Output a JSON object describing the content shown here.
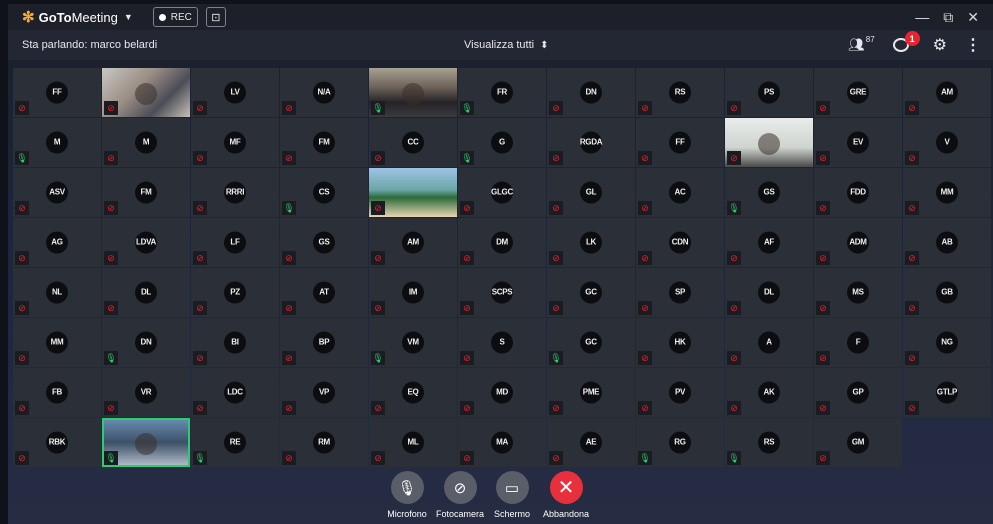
{
  "titlebar": {
    "app_name_bold": "GoTo",
    "app_name_rest": "Meeting",
    "rec_label": "REC",
    "minimize": "—",
    "restore": "⧉",
    "close": "✕"
  },
  "infobar": {
    "speaking": "Sta parlando: marco belardi",
    "view_all": "Visualizza tutti",
    "participants_count": "87",
    "chat_badge": "1"
  },
  "participants": [
    {
      "initials": "FF",
      "mic": "muted"
    },
    {
      "initials": "",
      "mic": "muted",
      "video": "vid1"
    },
    {
      "initials": "LV",
      "mic": "muted"
    },
    {
      "initials": "N/A",
      "mic": "muted"
    },
    {
      "initials": "",
      "mic": "on",
      "video": "vid2"
    },
    {
      "initials": "FR",
      "mic": "on"
    },
    {
      "initials": "DN",
      "mic": "muted"
    },
    {
      "initials": "RS",
      "mic": "muted"
    },
    {
      "initials": "PS",
      "mic": "muted"
    },
    {
      "initials": "GRE",
      "mic": "muted"
    },
    {
      "initials": "M",
      "mic": "on"
    },
    {
      "initials": "M",
      "mic": "muted"
    },
    {
      "initials": "MF",
      "mic": "muted"
    },
    {
      "initials": "FM",
      "mic": "muted"
    },
    {
      "initials": "CC",
      "mic": "muted"
    },
    {
      "initials": "G",
      "mic": "on"
    },
    {
      "initials": "RGDA",
      "mic": "muted"
    },
    {
      "initials": "FF",
      "mic": "muted"
    },
    {
      "initials": "",
      "mic": "muted",
      "video": "vid3"
    },
    {
      "initials": "EV",
      "mic": "muted"
    },
    {
      "initials": "ASV",
      "mic": "muted"
    },
    {
      "initials": "FM",
      "mic": "muted"
    },
    {
      "initials": "RRRI",
      "mic": "muted"
    },
    {
      "initials": "CS",
      "mic": "on"
    },
    {
      "initials": "",
      "mic": "muted",
      "video": "vid4"
    },
    {
      "initials": "GLGC",
      "mic": "muted"
    },
    {
      "initials": "GL",
      "mic": "muted"
    },
    {
      "initials": "AC",
      "mic": "muted"
    },
    {
      "initials": "GS",
      "mic": "on"
    },
    {
      "initials": "FDD",
      "mic": "muted"
    },
    {
      "initials": "AG",
      "mic": "muted"
    },
    {
      "initials": "LDVA",
      "mic": "muted"
    },
    {
      "initials": "LF",
      "mic": "muted"
    },
    {
      "initials": "GS",
      "mic": "muted"
    },
    {
      "initials": "AM",
      "mic": "muted"
    },
    {
      "initials": "DM",
      "mic": "muted"
    },
    {
      "initials": "LK",
      "mic": "muted"
    },
    {
      "initials": "CDN",
      "mic": "muted"
    },
    {
      "initials": "AF",
      "mic": "muted"
    },
    {
      "initials": "ADM",
      "mic": "muted"
    },
    {
      "initials": "NL",
      "mic": "muted"
    },
    {
      "initials": "DL",
      "mic": "muted"
    },
    {
      "initials": "PZ",
      "mic": "muted"
    },
    {
      "initials": "AT",
      "mic": "muted"
    },
    {
      "initials": "IM",
      "mic": "muted"
    },
    {
      "initials": "SCPS",
      "mic": "muted"
    },
    {
      "initials": "GC",
      "mic": "muted"
    },
    {
      "initials": "SP",
      "mic": "muted"
    },
    {
      "initials": "DL",
      "mic": "muted"
    },
    {
      "initials": "MS",
      "mic": "muted"
    },
    {
      "initials": "MM",
      "mic": "muted"
    },
    {
      "initials": "DN",
      "mic": "on"
    },
    {
      "initials": "BI",
      "mic": "muted"
    },
    {
      "initials": "BP",
      "mic": "muted"
    },
    {
      "initials": "VM",
      "mic": "on"
    },
    {
      "initials": "S",
      "mic": "muted"
    },
    {
      "initials": "GC",
      "mic": "on"
    },
    {
      "initials": "HK",
      "mic": "muted"
    },
    {
      "initials": "A",
      "mic": "muted"
    },
    {
      "initials": "F",
      "mic": "muted"
    },
    {
      "initials": "FB",
      "mic": "muted"
    },
    {
      "initials": "VR",
      "mic": "muted"
    },
    {
      "initials": "LDC",
      "mic": "muted"
    },
    {
      "initials": "VP",
      "mic": "muted"
    },
    {
      "initials": "EQ",
      "mic": "muted"
    },
    {
      "initials": "MD",
      "mic": "muted"
    },
    {
      "initials": "PME",
      "mic": "muted"
    },
    {
      "initials": "PV",
      "mic": "muted"
    },
    {
      "initials": "AK",
      "mic": "muted"
    },
    {
      "initials": "GP",
      "mic": "muted"
    },
    {
      "initials": "RBK",
      "mic": "muted"
    },
    {
      "initials": "",
      "mic": "on",
      "video": "vid5"
    },
    {
      "initials": "RE",
      "mic": "on"
    },
    {
      "initials": "RM",
      "mic": "muted"
    },
    {
      "initials": "ML",
      "mic": "muted"
    },
    {
      "initials": "MA",
      "mic": "muted"
    },
    {
      "initials": "AE",
      "mic": "muted"
    },
    {
      "initials": "RG",
      "mic": "on"
    },
    {
      "initials": "RS",
      "mic": "on"
    },
    {
      "initials": "GM",
      "mic": "muted"
    }
  ],
  "overflow_column": [
    {
      "initials": "AM",
      "mic": "muted"
    },
    {
      "initials": "V",
      "mic": "muted"
    },
    {
      "initials": "MM",
      "mic": "muted"
    },
    {
      "initials": "AB",
      "mic": "muted"
    },
    {
      "initials": "GB",
      "mic": "muted"
    },
    {
      "initials": "NG",
      "mic": "muted"
    },
    {
      "initials": "GTLP",
      "mic": "muted"
    }
  ],
  "controls": {
    "mic_label": "Microfono",
    "camera_label": "Fotocamera",
    "screen_label": "Schermo",
    "leave_label": "Abbandona"
  },
  "colors": {
    "accent_red": "#e8242f",
    "mic_on_green": "#2ecc71",
    "brand_orange": "#f2a93b"
  }
}
